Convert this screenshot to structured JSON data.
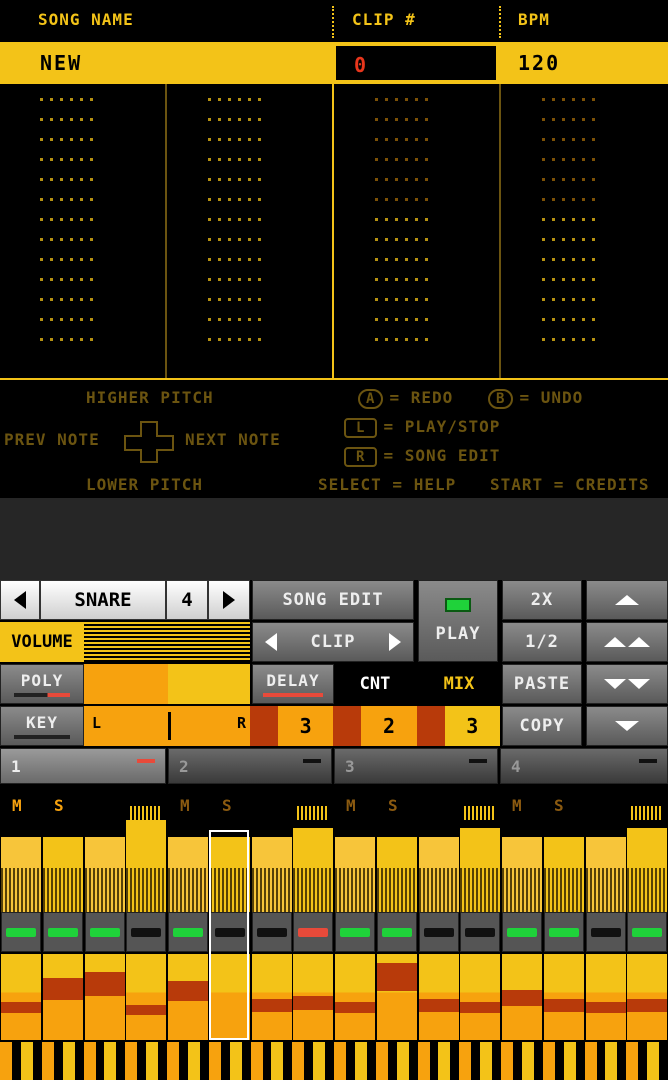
{
  "header": {
    "song_name_label": "SONG NAME",
    "clip_label": "CLIP #",
    "bpm_label": "BPM"
  },
  "values": {
    "song_name": "NEW",
    "clip_number": "0",
    "bpm": "120"
  },
  "help": {
    "higher_pitch": "HIGHER PITCH",
    "lower_pitch": "LOWER PITCH",
    "prev_note": "PREV NOTE",
    "next_note": "NEXT NOTE",
    "redo_key": "A",
    "redo": "= REDO",
    "undo_key": "B",
    "undo": "= UNDO",
    "play_key": "L",
    "play_stop": "= PLAY/STOP",
    "song_key": "R",
    "song_edit": "= SONG EDIT",
    "select_help": "SELECT = HELP",
    "start_credits": "START = CREDITS"
  },
  "controls": {
    "instrument": "SNARE",
    "instrument_num": "4",
    "song_edit": "SONG EDIT",
    "clip": "CLIP",
    "play": "PLAY",
    "x2": "2X",
    "half": "1/2",
    "paste": "PASTE",
    "copy": "COPY",
    "volume": "VOLUME",
    "poly": "POLY",
    "key": "KEY",
    "delay": "DELAY",
    "cnt": "CNT",
    "mix": "MIX",
    "pan_left": "L",
    "pan_right": "R",
    "delay_values": [
      "3",
      "2",
      "3"
    ]
  },
  "tracks": [
    "1",
    "2",
    "3",
    "4"
  ],
  "mute_label": "M",
  "solo_label": "S",
  "steps": {
    "tops": [
      0.82,
      0.82,
      0.82,
      1.0,
      0.82,
      0.82,
      0.82,
      0.91,
      0.82,
      0.82,
      0.82,
      0.91,
      0.82,
      0.82,
      0.82,
      0.91
    ],
    "leds": [
      "green",
      "green",
      "green",
      "off",
      "green",
      "off",
      "off",
      "red",
      "green",
      "green",
      "off",
      "off",
      "green",
      "green",
      "off",
      "green"
    ],
    "bottom": [
      0.2,
      0.6,
      0.7,
      0.15,
      0.55,
      0.0,
      0.25,
      0.3,
      0.2,
      0.85,
      0.25,
      0.2,
      0.4,
      0.25,
      0.2,
      0.25
    ]
  },
  "colors": {
    "accent": "#f3c318",
    "orange": "#f7a20e",
    "dark_red": "#b83a0a",
    "led_green": "#1fd23a",
    "led_red": "#e84a3a"
  }
}
